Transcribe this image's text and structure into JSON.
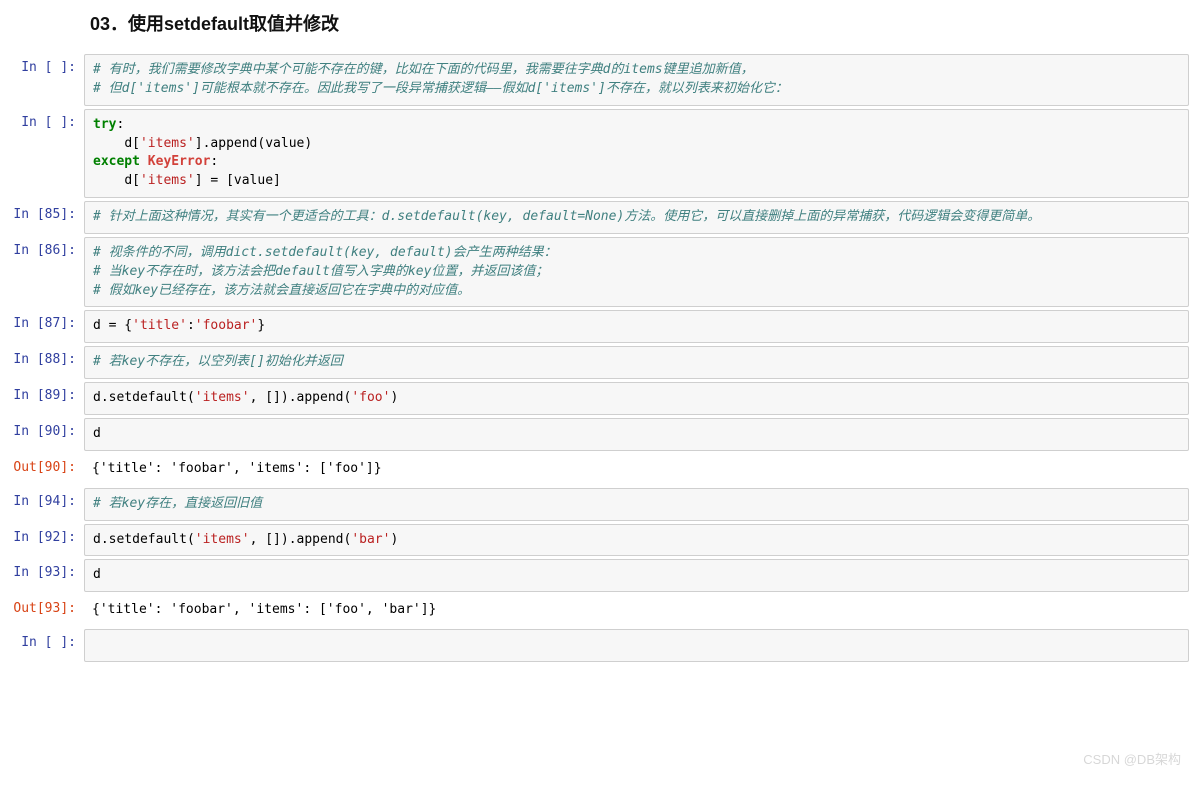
{
  "title": "03．使用setdefault取值并修改",
  "watermark": "CSDN @DB架构",
  "cells": [
    {
      "type": "code",
      "prompt_in": "In [ ]:",
      "tokens": [
        {
          "cls": "c-comment",
          "t": "# 有时，我们需要修改字典中某个可能不存在的键，比如在下面的代码里，我需要往字典d的items键里追加新值，"
        },
        {
          "cls": "",
          "t": "\n"
        },
        {
          "cls": "c-comment",
          "t": "# 但d['items']可能根本就不存在。因此我写了一段异常捕获逻辑——假如d['items']不存在，就以列表来初始化它："
        }
      ]
    },
    {
      "type": "code",
      "prompt_in": "In [ ]:",
      "tokens": [
        {
          "cls": "c-keyword",
          "t": "try"
        },
        {
          "cls": "c-punc",
          "t": ":"
        },
        {
          "cls": "",
          "t": "\n    "
        },
        {
          "cls": "c-name",
          "t": "d"
        },
        {
          "cls": "c-punc",
          "t": "["
        },
        {
          "cls": "c-str",
          "t": "'items'"
        },
        {
          "cls": "c-punc",
          "t": "]."
        },
        {
          "cls": "c-name",
          "t": "append"
        },
        {
          "cls": "c-punc",
          "t": "("
        },
        {
          "cls": "c-name",
          "t": "value"
        },
        {
          "cls": "c-punc",
          "t": ")"
        },
        {
          "cls": "",
          "t": "\n"
        },
        {
          "cls": "c-keyword",
          "t": "except"
        },
        {
          "cls": "",
          "t": " "
        },
        {
          "cls": "c-exc",
          "t": "KeyError"
        },
        {
          "cls": "c-punc",
          "t": ":"
        },
        {
          "cls": "",
          "t": "\n    "
        },
        {
          "cls": "c-name",
          "t": "d"
        },
        {
          "cls": "c-punc",
          "t": "["
        },
        {
          "cls": "c-str",
          "t": "'items'"
        },
        {
          "cls": "c-punc",
          "t": "] = ["
        },
        {
          "cls": "c-name",
          "t": "value"
        },
        {
          "cls": "c-punc",
          "t": "]"
        }
      ]
    },
    {
      "type": "code",
      "scroll": true,
      "prompt_in": "In [85]:",
      "tokens": [
        {
          "cls": "c-comment",
          "t": "# 针对上面这种情况，其实有一个更适合的工具：d.setdefault(key, default=None)方法。使用它，可以直接删掉上面的异常捕获，代码逻辑会变得更简单。"
        }
      ]
    },
    {
      "type": "code",
      "prompt_in": "In [86]:",
      "tokens": [
        {
          "cls": "c-comment",
          "t": "# 视条件的不同，调用dict.setdefault(key, default)会产生两种结果："
        },
        {
          "cls": "",
          "t": "\n"
        },
        {
          "cls": "c-comment",
          "t": "# 当key不存在时，该方法会把default值写入字典的key位置，并返回该值；"
        },
        {
          "cls": "",
          "t": "\n"
        },
        {
          "cls": "c-comment",
          "t": "# 假如key已经存在，该方法就会直接返回它在字典中的对应值。"
        }
      ]
    },
    {
      "type": "code",
      "prompt_in": "In [87]:",
      "tokens": [
        {
          "cls": "c-name",
          "t": "d "
        },
        {
          "cls": "c-punc",
          "t": "= {"
        },
        {
          "cls": "c-str",
          "t": "'title'"
        },
        {
          "cls": "c-punc",
          "t": ":"
        },
        {
          "cls": "c-str",
          "t": "'foobar'"
        },
        {
          "cls": "c-punc",
          "t": "}"
        }
      ]
    },
    {
      "type": "code",
      "prompt_in": "In [88]:",
      "tokens": [
        {
          "cls": "c-comment",
          "t": "# 若key不存在，以空列表[]初始化并返回"
        }
      ]
    },
    {
      "type": "code",
      "prompt_in": "In [89]:",
      "tokens": [
        {
          "cls": "c-name",
          "t": "d"
        },
        {
          "cls": "c-punc",
          "t": "."
        },
        {
          "cls": "c-name",
          "t": "setdefault"
        },
        {
          "cls": "c-punc",
          "t": "("
        },
        {
          "cls": "c-str",
          "t": "'items'"
        },
        {
          "cls": "c-punc",
          "t": ", [])."
        },
        {
          "cls": "c-name",
          "t": "append"
        },
        {
          "cls": "c-punc",
          "t": "("
        },
        {
          "cls": "c-str",
          "t": "'foo'"
        },
        {
          "cls": "c-punc",
          "t": ")"
        }
      ]
    },
    {
      "type": "code",
      "prompt_in": "In [90]:",
      "tokens": [
        {
          "cls": "c-name",
          "t": "d"
        }
      ],
      "output_prompt": "Out[90]:",
      "output_text": "{'title': 'foobar', 'items': ['foo']}"
    },
    {
      "type": "code",
      "prompt_in": "In [94]:",
      "tokens": [
        {
          "cls": "c-comment",
          "t": "# 若key存在，直接返回旧值"
        }
      ]
    },
    {
      "type": "code",
      "prompt_in": "In [92]:",
      "tokens": [
        {
          "cls": "c-name",
          "t": "d"
        },
        {
          "cls": "c-punc",
          "t": "."
        },
        {
          "cls": "c-name",
          "t": "setdefault"
        },
        {
          "cls": "c-punc",
          "t": "("
        },
        {
          "cls": "c-str",
          "t": "'items'"
        },
        {
          "cls": "c-punc",
          "t": ", [])."
        },
        {
          "cls": "c-name",
          "t": "append"
        },
        {
          "cls": "c-punc",
          "t": "("
        },
        {
          "cls": "c-str",
          "t": "'bar'"
        },
        {
          "cls": "c-punc",
          "t": ")"
        }
      ]
    },
    {
      "type": "code",
      "prompt_in": "In [93]:",
      "tokens": [
        {
          "cls": "c-name",
          "t": "d"
        }
      ],
      "output_prompt": "Out[93]:",
      "output_text": "{'title': 'foobar', 'items': ['foo', 'bar']}"
    },
    {
      "type": "code",
      "prompt_in": "In [ ]:",
      "tokens": []
    }
  ]
}
